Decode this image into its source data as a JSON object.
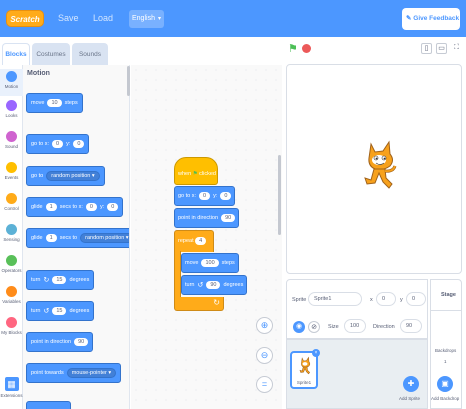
{
  "menu": {
    "logo": "Scratch",
    "save": "Save",
    "load": "Load",
    "language": "English",
    "feedback": "Give Feedback"
  },
  "tabs": [
    "Blocks",
    "Costumes",
    "Sounds"
  ],
  "categories": [
    {
      "label": "Motion",
      "color": "#4c97ff"
    },
    {
      "label": "Looks",
      "color": "#9966ff"
    },
    {
      "label": "Sound",
      "color": "#cf63cf"
    },
    {
      "label": "Events",
      "color": "#ffbf00"
    },
    {
      "label": "Control",
      "color": "#ffab19"
    },
    {
      "label": "Sensing",
      "color": "#5cb1d6"
    },
    {
      "label": "Operators",
      "color": "#59c059"
    },
    {
      "label": "Variables",
      "color": "#ff8c1a"
    },
    {
      "label": "My Blocks",
      "color": "#ff6680"
    }
  ],
  "extensions_label": "Extensions",
  "palette": {
    "title": "Motion",
    "move": {
      "a": "move",
      "v": "10",
      "b": "steps"
    },
    "goto_xy": {
      "a": "go to x:",
      "x": "0",
      "b": "y:",
      "y": "0"
    },
    "goto": {
      "a": "go to",
      "opt": "random position ▾"
    },
    "glide_xy": {
      "a": "glide",
      "s": "1",
      "b": "secs to x:",
      "x": "0",
      "c": "y:",
      "y": "0"
    },
    "glide": {
      "a": "glide",
      "s": "1",
      "b": "secs to",
      "opt": "random position ▾"
    },
    "turn_right": {
      "a": "turn",
      "v": "15",
      "b": "degrees"
    },
    "turn_left": {
      "a": "turn",
      "v": "15",
      "b": "degrees"
    },
    "point_dir": {
      "a": "point in direction",
      "v": "90"
    },
    "point_towards": {
      "a": "point towards",
      "opt": "mouse-pointer ▾"
    }
  },
  "script": {
    "hat_a": "when",
    "hat_b": "clicked",
    "goto": {
      "a": "go to x:",
      "x": "0",
      "b": "y:",
      "y": "0"
    },
    "point": {
      "a": "point in direction",
      "v": "90"
    },
    "repeat": {
      "a": "repeat",
      "v": "4"
    },
    "move": {
      "a": "move",
      "v": "100",
      "b": "steps"
    },
    "turn": {
      "a": "turn",
      "v": "90",
      "b": "degrees"
    }
  },
  "sprite": {
    "label": "Sprite",
    "name": "Sprite1",
    "x_label": "x",
    "x": "0",
    "y_label": "y",
    "y": "0",
    "size_label": "Size",
    "size": "100",
    "direction_label": "Direction",
    "direction": "90",
    "thumb_name": "Sprite1"
  },
  "stage_panel": {
    "title": "Stage",
    "backdrops_label": "Backdrops",
    "backdrops_count": "1"
  },
  "buttons": {
    "add_sprite": "Add Sprite",
    "add_backdrop": "Add Backdrop"
  }
}
